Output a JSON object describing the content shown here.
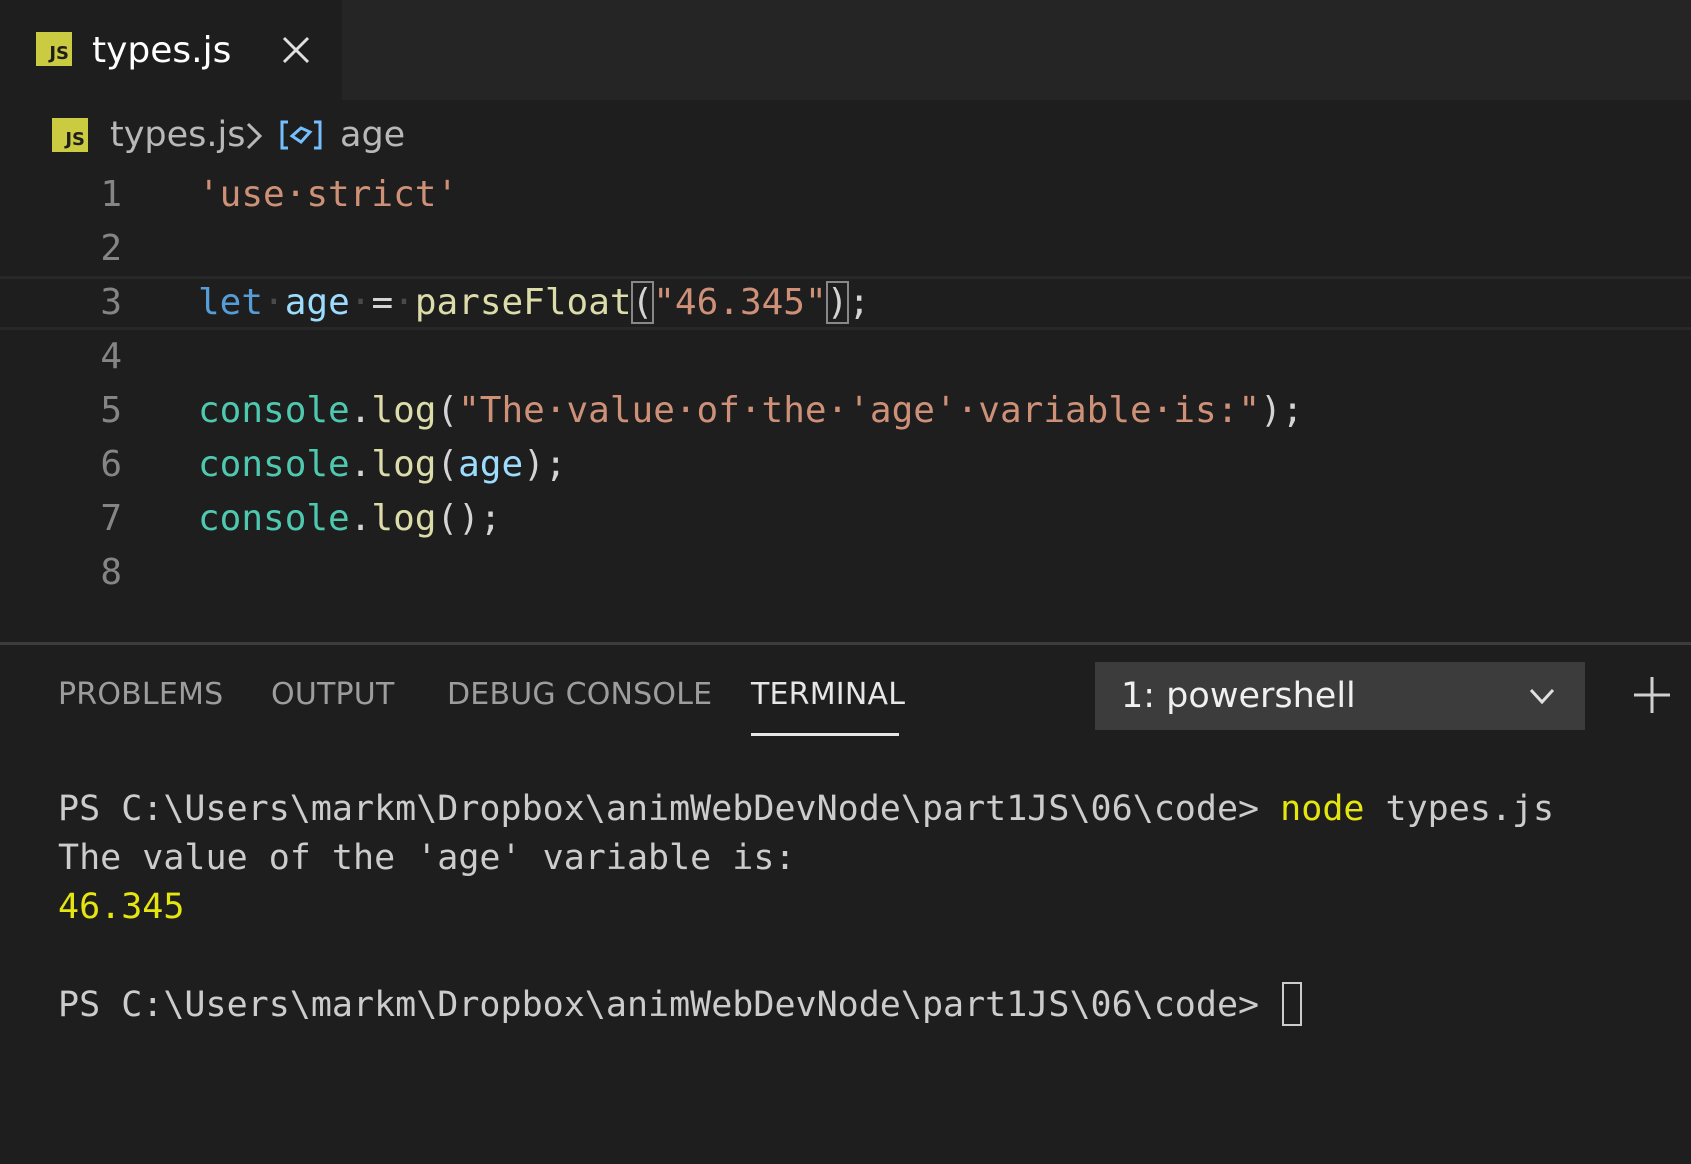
{
  "tab": {
    "badge": "JS",
    "filename": "types.js"
  },
  "breadcrumb": {
    "badge": "JS",
    "file": "types.js",
    "symbol": "age"
  },
  "editor": {
    "line_numbers": [
      "1",
      "2",
      "3",
      "4",
      "5",
      "6",
      "7",
      "8"
    ],
    "lines": [
      {
        "str": "'use·strict'"
      },
      {},
      {
        "kw": "let",
        "ws1": "·",
        "var": "age",
        "ws2": "·",
        "eq": "=",
        "ws3": "·",
        "fn": "parseFloat",
        "open": "(",
        "str": "\"46.345\"",
        "close": ")",
        "semi": ";"
      },
      {},
      {
        "cls": "console",
        "dot": ".",
        "fn": "log",
        "open": "(",
        "str": "\"The·value·of·the·'age'·variable·is:\"",
        "close": ");"
      },
      {
        "cls": "console",
        "dot": ".",
        "fn": "log",
        "open": "(",
        "var": "age",
        "close": ");"
      },
      {
        "cls": "console",
        "dot": ".",
        "fn": "log",
        "close": "();"
      },
      {}
    ]
  },
  "panel": {
    "tabs": [
      "PROBLEMS",
      "OUTPUT",
      "DEBUG CONSOLE",
      "TERMINAL"
    ],
    "terminal_select": "1: powershell"
  },
  "terminal": {
    "prompt1": "PS C:\\Users\\markm\\Dropbox\\animWebDevNode\\part1JS\\06\\code> ",
    "cmd": "node",
    "cmd_args": " types.js",
    "out1": "The value of the 'age' variable is:",
    "out2": "46.345",
    "prompt2": "PS C:\\Users\\markm\\Dropbox\\animWebDevNode\\part1JS\\06\\code> "
  },
  "colors": {
    "background": "#1e1e1e",
    "string": "#ce9178",
    "keyword": "#569cd6",
    "variable": "#9cdcfe",
    "function": "#dcdcaa",
    "class": "#4ec9b0",
    "terminal_yellow": "#e5e510",
    "js_badge": "#cbcb41"
  },
  "icons": {
    "js_file": "js-icon",
    "close": "close-icon",
    "breadcrumb_separator": "chevron-right-icon",
    "variable_symbol": "variable-icon",
    "dropdown": "chevron-down-icon",
    "new_terminal": "plus-icon"
  }
}
